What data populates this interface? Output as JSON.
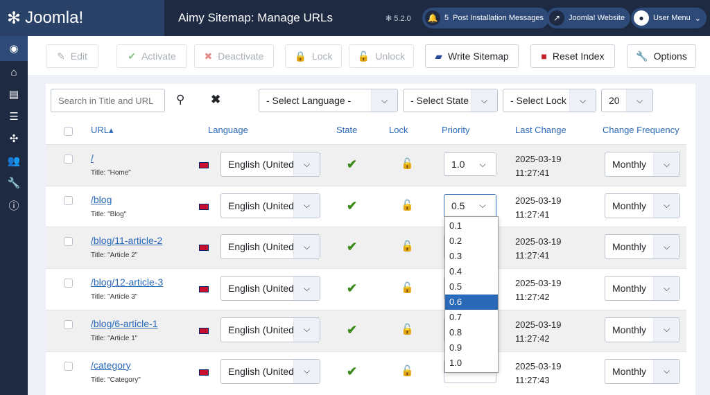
{
  "header": {
    "brand": "Joomla!",
    "title": "Aimy Sitemap: Manage URLs",
    "version": "5.2.0",
    "notifications_count": "5",
    "post_install": "Post Installation Messages",
    "website": "Joomla! Website",
    "user_menu": "User Menu"
  },
  "sidebar": [
    "toggle-menu",
    "home",
    "content",
    "menu",
    "components",
    "users",
    "system",
    "help"
  ],
  "toolbar": {
    "edit": "Edit",
    "activate": "Activate",
    "deactivate": "Deactivate",
    "lock": "Lock",
    "unlock": "Unlock",
    "write_sitemap": "Write Sitemap",
    "reset_index": "Reset Index",
    "options": "Options"
  },
  "filters": {
    "search_placeholder": "Search in Title and URL",
    "language": "- Select Language -",
    "state": "- Select State -",
    "lock": "- Select Lock -",
    "limit": "20"
  },
  "columns": {
    "url": "URL",
    "language": "Language",
    "state": "State",
    "lock": "Lock",
    "priority": "Priority",
    "last_change": "Last Change",
    "frequency": "Change Frequency"
  },
  "rows": [
    {
      "url": "/",
      "title": "Title: \"Home\"",
      "language": "English (United",
      "priority": "1.0",
      "date": "2025-03-19",
      "time": "11:27:41",
      "freq": "Monthly"
    },
    {
      "url": "/blog",
      "title": "Title: \"Blog\"",
      "language": "English (United",
      "priority": "0.5",
      "date": "2025-03-19",
      "time": "11:27:41",
      "freq": "Monthly"
    },
    {
      "url": "/blog/11-article-2",
      "title": "Title: \"Article 2\"",
      "language": "English (United",
      "priority": "",
      "date": "2025-03-19",
      "time": "11:27:41",
      "freq": "Monthly"
    },
    {
      "url": "/blog/12-article-3",
      "title": "Title: \"Article 3\"",
      "language": "English (United",
      "priority": "",
      "date": "2025-03-19",
      "time": "11:27:42",
      "freq": "Monthly"
    },
    {
      "url": "/blog/6-article-1",
      "title": "Title: \"Article 1\"",
      "language": "English (United",
      "priority": "",
      "date": "2025-03-19",
      "time": "11:27:42",
      "freq": "Monthly"
    },
    {
      "url": "/category",
      "title": "Title: \"Category\"",
      "language": "English (United",
      "priority": "",
      "date": "2025-03-19",
      "time": "11:27:43",
      "freq": "Monthly"
    }
  ],
  "priority_dropdown": {
    "options": [
      "0.1",
      "0.2",
      "0.3",
      "0.4",
      "0.5",
      "0.6",
      "0.7",
      "0.8",
      "0.9",
      "1.0"
    ],
    "highlighted": "0.6"
  }
}
